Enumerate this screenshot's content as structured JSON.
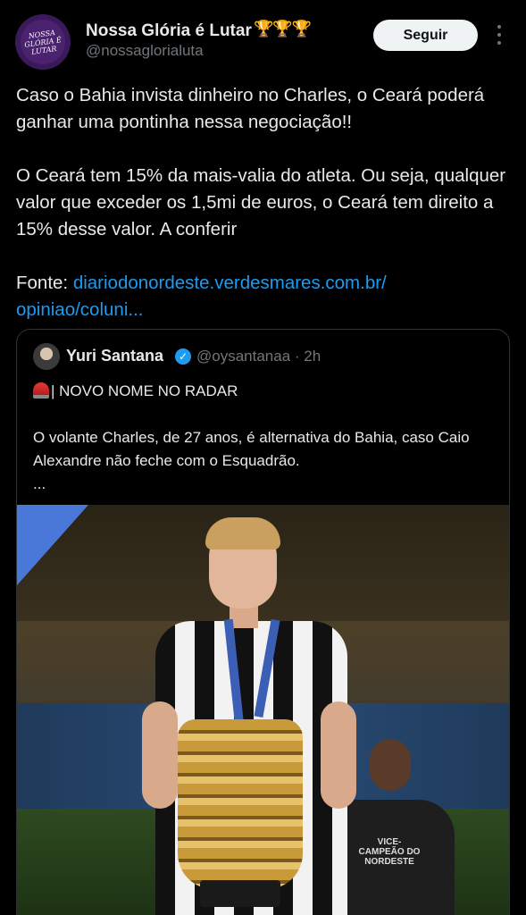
{
  "author": {
    "name": "Nossa Glória é Lutar",
    "badges": "🏆🏆🏆",
    "handle": "@nossaglorialuta",
    "avatar_text": "NOSSA GLÓRIA É LUTAR"
  },
  "follow_label": "Seguir",
  "more_icon": "ellipsis-vertical-icon",
  "tweet": {
    "line1": "Caso o Bahia invista dinheiro no Charles, o Ceará poderá ganhar uma pontinha nessa negociação!!",
    "line2": "O Ceará tem 15% da mais-valia do atleta. Ou seja, qualquer valor que exceder os 1,5mi de  euros, o Ceará tem direito a 15% desse valor. A conferir",
    "source_label": "Fonte: ",
    "source_link": "diariodonordeste.verdesmares.com.br/ opiniao/coluni..."
  },
  "quote": {
    "name": "Yuri Santana",
    "handle_time": "@oysantanaa · 2h",
    "headline": "| NOVO NOME NO RADAR",
    "body": "O volante Charles, de 27 anos, é alternativa do Bahia, caso Caio Alexandre não feche com o Esquadrão.",
    "ellipsis": "...",
    "shirt_text": "VICE-CAMPEÃO DO NORDESTE"
  },
  "colors": {
    "background": "#000000",
    "text": "#e7e9ea",
    "secondary": "#71767b",
    "link": "#1d9bf0",
    "verified": "#1d9bf0"
  }
}
